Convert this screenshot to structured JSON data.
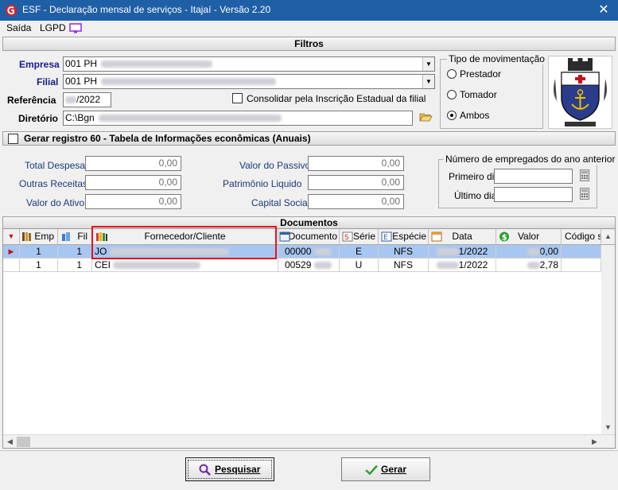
{
  "window": {
    "title": "ESF - Declaração mensal de serviços - Itajaí - Versão 2.20",
    "close_symbol": "✕"
  },
  "menu": {
    "items": [
      "Saída",
      "LGPD"
    ]
  },
  "filtros": {
    "header": "Filtros",
    "empresa_label": "Empresa",
    "empresa_value": "001 PH",
    "filial_label": "Filial",
    "filial_value": "001 PH",
    "referencia_label": "Referência",
    "referencia_value": "/2022",
    "diretorio_label": "Diretório",
    "diretorio_value": "C:\\Bgn",
    "consolidar_label": "Consolidar pela Inscrição Estadual da filial",
    "tipo_mov": {
      "title": "Tipo de movimentação",
      "options": [
        "Prestador",
        "Tomador",
        "Ambos"
      ],
      "selected": "Ambos"
    }
  },
  "registro60": {
    "label": "Gerar registro 60 - Tabela de Informações econômicas (Anuais)",
    "total_despesa_label": "Total Despesa",
    "total_despesa": "0,00",
    "outras_receitas_label": "Outras Receitas",
    "outras_receitas": "0,00",
    "valor_ativo_label": "Valor do Ativo",
    "valor_ativo": "0,00",
    "valor_passivo_label": "Valor do Passivo",
    "valor_passivo": "0,00",
    "patrimonio_label": "Patrimônio Liquido",
    "patrimonio": "0,00",
    "capital_label": "Capital Social",
    "capital": "0,00",
    "empregados": {
      "title": "Número de empregados do ano anterior",
      "primeiro_label": "Primeiro dia",
      "ultimo_label": "Último dia"
    }
  },
  "documentos": {
    "header": "Documentos",
    "columns": [
      "Emp",
      "Fil",
      "Fornecedor/Cliente",
      "Documento",
      "Série",
      "Espécie",
      "Data",
      "Valor",
      "Código sit"
    ],
    "rows": [
      {
        "emp": "1",
        "fil": "1",
        "fornecedor": "JO",
        "documento": "00000",
        "serie": "E",
        "especie": "NFS",
        "data": "1/2022",
        "valor": "0,00"
      },
      {
        "emp": "1",
        "fil": "1",
        "fornecedor": "CEI",
        "documento": "00529",
        "serie": "U",
        "especie": "NFS",
        "data": "1/2022",
        "valor": "2,78"
      }
    ]
  },
  "buttons": {
    "pesquisar": "Pesquisar",
    "gerar": "Gerar"
  },
  "colors": {
    "titlebar": "#1f5fa6",
    "selected_row": "#a8c7f0",
    "highlight": "#e0141e",
    "label_blue": "#1a1a8e"
  }
}
